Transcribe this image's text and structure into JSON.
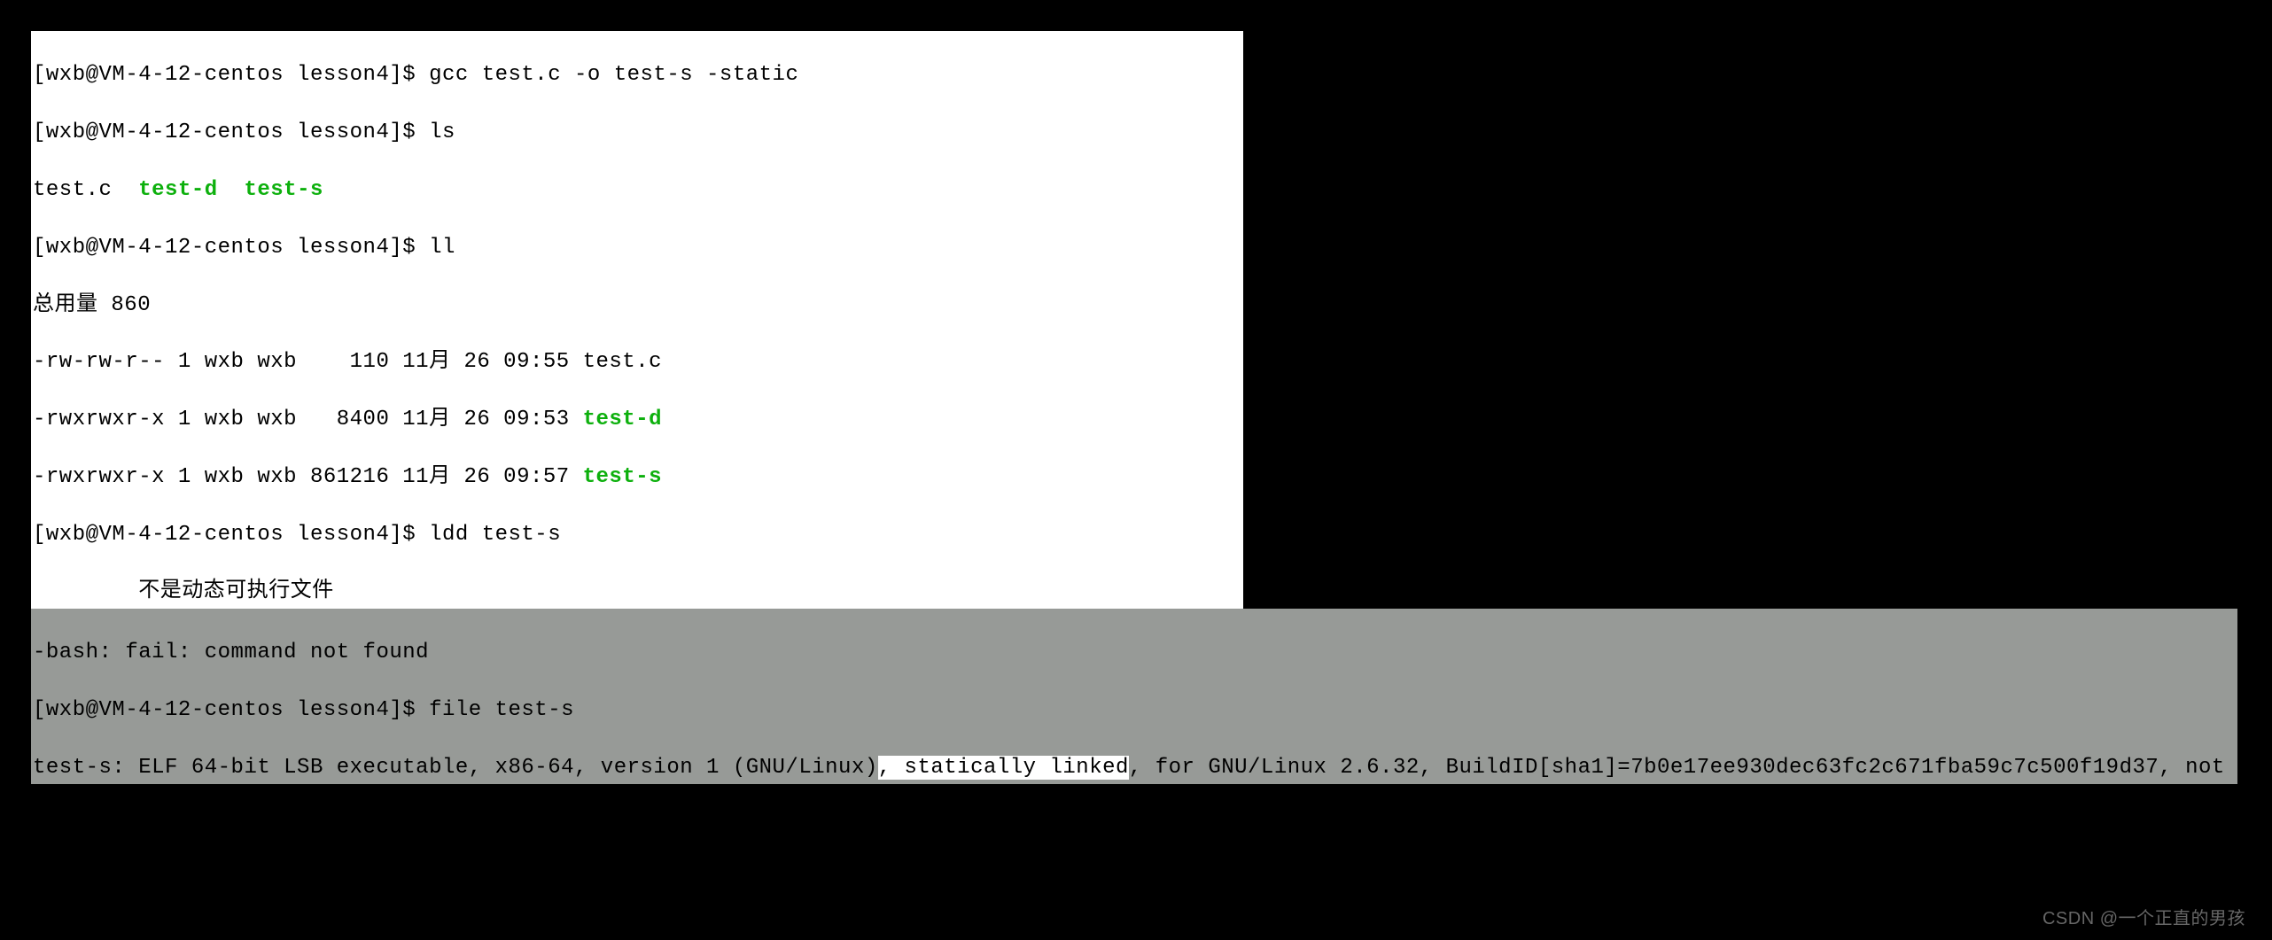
{
  "terminal": {
    "prompt1": "[wxb@VM-4-12-centos lesson4]$ ",
    "cmd1": "gcc test.c -o test-s -static",
    "cmd2": "ls",
    "ls_output": {
      "file1": "test.c",
      "file2": "test-d",
      "file3": "test-s",
      "spacing12": "  ",
      "spacing23": "  "
    },
    "cmd3": "ll",
    "ll_output": {
      "total": "总用量 860",
      "row1_attrs": "-rw-rw-r-- 1 wxb wxb    110 11月 26 09:55 ",
      "row1_name": "test.c",
      "row2_attrs": "-rwxrwxr-x 1 wxb wxb   8400 11月 26 09:53 ",
      "row2_name": "test-d",
      "row3_attrs": "-rwxrwxr-x 1 wxb wxb 861216 11月 26 09:57 ",
      "row3_name": "test-s"
    },
    "cmd4": "ldd test-s",
    "ldd_output": "        不是动态可执行文件",
    "bash_error": "-bash: fail: command not found",
    "cmd5": "file test-s",
    "file_output": {
      "part1": "test-s: ELF 64-bit LSB executable, x86-64, version 1 (GNU/Linux)",
      "highlighted": ", statically linked",
      "part2": ", for GNU/Linux 2.6.32, BuildID[sha1]=7b0e17ee930dec63fc2c671fba59c7c500f19d37, not stripped"
    }
  },
  "watermark": "CSDN @一个正直的男孩"
}
